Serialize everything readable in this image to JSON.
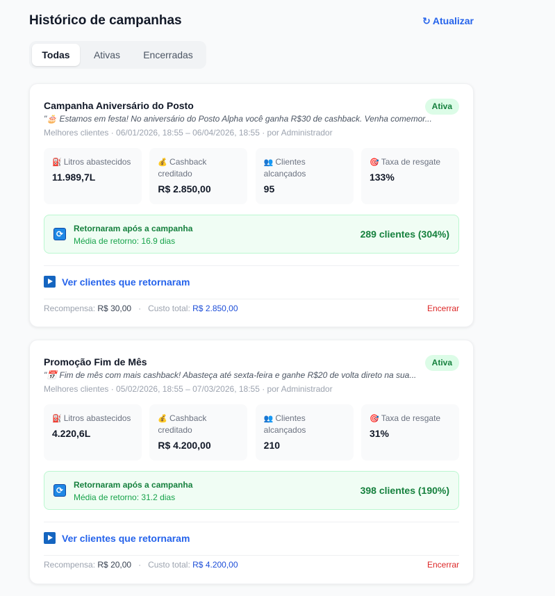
{
  "header": {
    "title": "Histórico de campanhas",
    "refresh_icon": "↻",
    "refresh_label": "Atualizar"
  },
  "tabs": [
    {
      "label": "Todas",
      "active": true
    },
    {
      "label": "Ativas",
      "active": false
    },
    {
      "label": "Encerradas",
      "active": false
    }
  ],
  "campaigns": [
    {
      "title": "Campanha Aniversário do Posto",
      "status": "Ativa",
      "message": "\"🎂 Estamos em festa! No aniversário do Posto Alpha você ganha R$30 de cashback. Venha comemor...",
      "meta": "Melhores clientes · 06/01/2026, 18:55 – 06/04/2026, 18:55 · por Administrador",
      "stats": [
        {
          "icon": "⛽",
          "label": "Litros abastecidos",
          "value": "11.989,7L"
        },
        {
          "icon": "💰",
          "label": "Cashback creditado",
          "value": "R$ 2.850,00"
        },
        {
          "icon": "👥",
          "label": "Clientes alcançados",
          "value": "95"
        },
        {
          "icon": "🎯",
          "label": "Taxa de resgate",
          "value": "133%"
        }
      ],
      "returned": {
        "icon": "🔄",
        "title": "Retornaram após a campanha",
        "subtitle": "Média de retorno: 16.9 dias",
        "count": "289 clientes (304%)"
      },
      "view_link": "Ver clientes que retornaram",
      "footer": {
        "reward_label": "Recompensa:",
        "reward_value": "R$ 30,00",
        "cost_label": "Custo total:",
        "cost_value": "R$ 2.850,00",
        "end_label": "Encerrar"
      }
    },
    {
      "title": "Promoção Fim de Mês",
      "status": "Ativa",
      "message": "\"📅 Fim de mês com mais cashback! Abasteça até sexta-feira e ganhe R$20 de volta direto na sua...",
      "meta": "Melhores clientes · 05/02/2026, 18:55 – 07/03/2026, 18:55 · por Administrador",
      "stats": [
        {
          "icon": "⛽",
          "label": "Litros abastecidos",
          "value": "4.220,6L"
        },
        {
          "icon": "💰",
          "label": "Cashback creditado",
          "value": "R$ 4.200,00"
        },
        {
          "icon": "👥",
          "label": "Clientes alcançados",
          "value": "210"
        },
        {
          "icon": "🎯",
          "label": "Taxa de resgate",
          "value": "31%"
        }
      ],
      "returned": {
        "icon": "🔄",
        "title": "Retornaram após a campanha",
        "subtitle": "Média de retorno: 31.2 dias",
        "count": "398 clientes (190%)"
      },
      "view_link": "Ver clientes que retornaram",
      "footer": {
        "reward_label": "Recompensa:",
        "reward_value": "R$ 20,00",
        "cost_label": "Custo total:",
        "cost_value": "R$ 4.200,00",
        "end_label": "Encerrar"
      }
    }
  ]
}
